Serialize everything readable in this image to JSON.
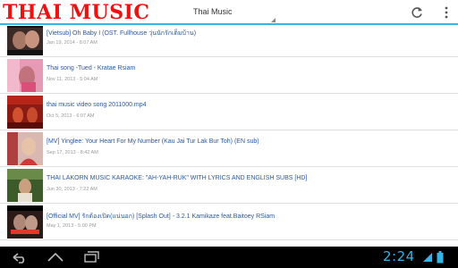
{
  "app": {
    "logo_text": "THAI MUSIC",
    "spinner_value": "Thai Music"
  },
  "actionbar": {
    "refresh_icon": "refresh-icon",
    "overflow_icon": "overflow-menu-icon",
    "accent_color": "#33b5e5"
  },
  "videos": [
    {
      "title": "[Vietsub] Oh Baby I (OST. Fullhouse วุ่นนักรักเต็มบ้าน)",
      "date": "Jan 19, 2014 - 8:07 AM"
    },
    {
      "title": "Thai song -Tued - Kratae Rsiam",
      "date": "Nov 11, 2013 - 5:04 AM"
    },
    {
      "title": "thai music video song 2011000.mp4",
      "date": "Oct 5, 2013 - 6:07 AM"
    },
    {
      "title": "[MV] Yinglee: Your Heart For My Number (Kau Jai Tur Lak Bur Toh) (EN sub)",
      "date": "Sep 17, 2013 - 8:42 AM"
    },
    {
      "title": "THAI LAKORN MUSIC KARAOKE: \"AH-YAH-RUK\" WITH LYRICS AND ENGLISH SUBS [HD]",
      "date": "Jun 30, 2013 - 7:22 AM"
    },
    {
      "title": "[Official MV] รักต้องเปิด(แน่นอก) [Splash Out] - 3.2.1 Kamikaze feat.Baitoey RSiam",
      "date": "May 1, 2013 - 5:00 PM"
    }
  ],
  "statusbar": {
    "time": "2:24"
  }
}
